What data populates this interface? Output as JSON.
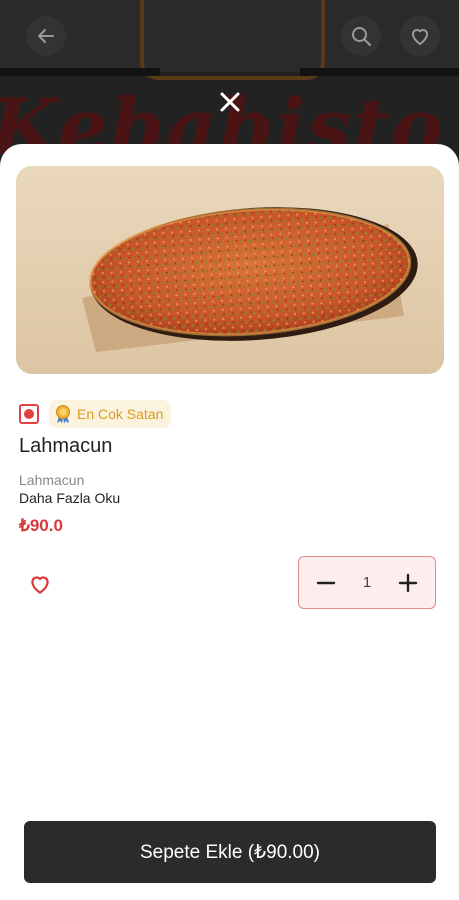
{
  "colors": {
    "accent": "#d63a3a",
    "cta_bg": "#2b2b2b",
    "badge_text": "#d99a1e",
    "badge_bg": "#fcf3df",
    "qty_border": "#e08a8a",
    "qty_bg": "#fdeeee"
  },
  "background": {
    "logo_text": "Kebabisto",
    "back_icon": "arrow-left-icon",
    "search_icon": "search-icon",
    "favorite_icon": "heart-outline-icon"
  },
  "modal": {
    "close_icon": "close-icon"
  },
  "product": {
    "image": "lahmacun-photo",
    "veg_indicator": "non-veg-indicator-icon",
    "badge_label": "En Cok Satan",
    "badge_icon": "award-ribbon-icon",
    "name": "Lahmacun",
    "description": "Lahmacun",
    "read_more": "Daha Fazla Oku",
    "price": "₺90.0"
  },
  "actions": {
    "favorite_icon": "heart-outline-icon",
    "decrement_icon": "minus-icon",
    "increment_icon": "plus-icon",
    "quantity": "1",
    "add_to_cart": "Sepete Ekle (₺90.00)"
  }
}
